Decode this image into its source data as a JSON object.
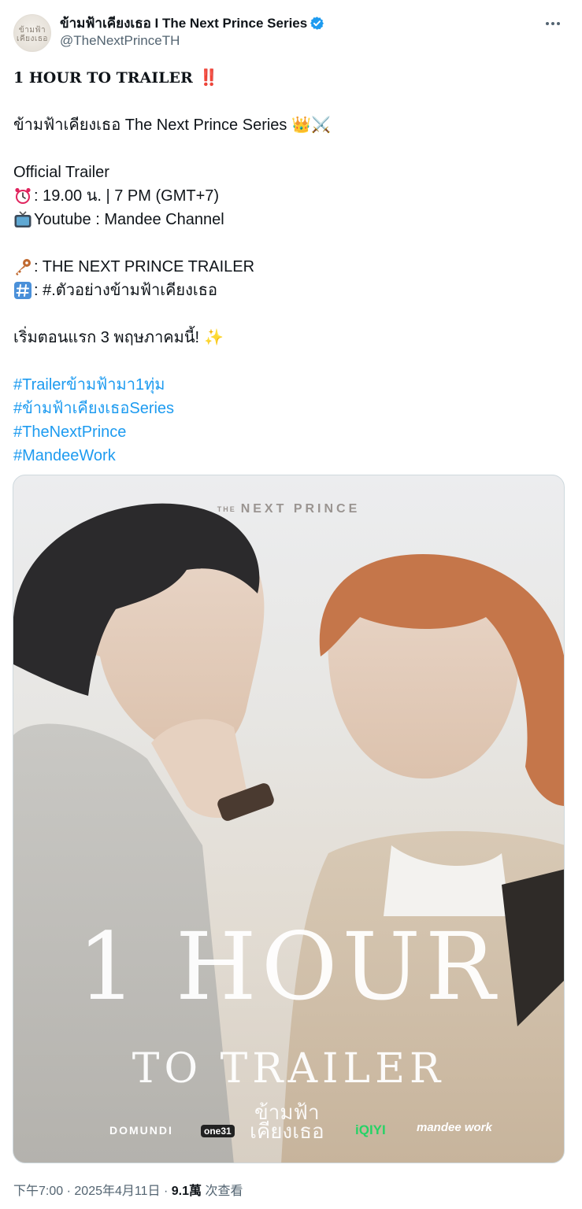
{
  "account": {
    "display_name": "ข้ามฟ้าเคียงเธอ I The Next Prince Series",
    "handle": "@TheNextPrinceTH",
    "avatar_logo_text": "ข้ามฟ้า เคียงเธอ",
    "verified_icon": "verified-badge-icon",
    "verified_color": "#1d9bf0"
  },
  "tweet": {
    "headline": "1 HOUR TO TRAILER",
    "headline_emoji": "‼️",
    "series_line": "ข้ามฟ้าเคียงเธอ The Next Prince Series",
    "series_emoji": "👑⚔️",
    "trailer_label": "Official Trailer",
    "time_line": ": 19.00 น. | 7 PM (GMT+7)",
    "channel_line": "Youtube : Mandee Channel",
    "key_line": ": THE NEXT PRINCE TRAILER",
    "hash_line": ": #.ตัวอย่างข้ามฟ้าเคียงเธอ",
    "premiere_line": "เริ่มตอนแรก 3 พฤษภาคมนี้!",
    "premiere_emoji": "✨",
    "hashtags": [
      "#Trailerข้ามฟ้ามา1ทุ่ม",
      "#ข้ามฟ้าเคียงเธอSeries",
      "#TheNextPrince",
      "#MandeeWork"
    ],
    "link_color": "#1d9bf0"
  },
  "poster": {
    "brand_prefix": "THE",
    "brand": "NEXT PRINCE",
    "big_text": "1 HOUR",
    "mid_text": "TO TRAILER",
    "thai_title_line1": "ข้ามฟ้า",
    "thai_title_line2": "เคียงเธอ",
    "logos": [
      "DOMUNDI",
      "one31",
      "iQIYI",
      "mandee work"
    ]
  },
  "meta": {
    "time": "下午7:00",
    "date": "2025年4月11日",
    "views": "9.1萬",
    "views_label": "次查看",
    "separator": "·"
  }
}
